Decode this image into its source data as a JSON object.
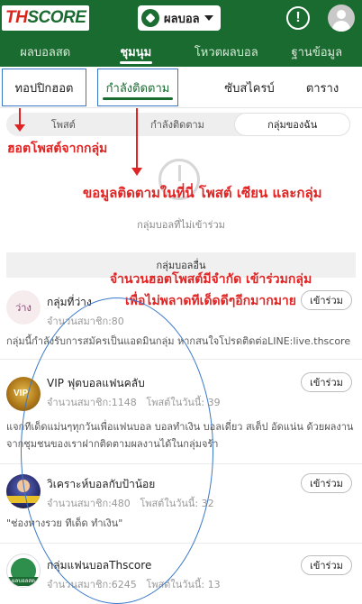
{
  "header": {
    "logo_th": "TH",
    "logo_score": "SCORE",
    "sport_select": "ผลบอล",
    "alert_icon": "!",
    "colors": {
      "brand_green": "#196b2f",
      "accent_red": "#e02424"
    }
  },
  "main_nav": {
    "tabs": [
      {
        "label": "ผลบอลสด"
      },
      {
        "label": "ชุมนุม"
      },
      {
        "label": "โหวตผลบอล"
      },
      {
        "label": "ฐานข้อมูล"
      }
    ]
  },
  "sub_tabs": {
    "tabs": [
      {
        "label": "ทอปปิกฮอต"
      },
      {
        "label": "กำลังติดตาม"
      },
      {
        "label": "ซับสไครบ์"
      },
      {
        "label": "ตาราง"
      }
    ]
  },
  "segment": {
    "options": [
      {
        "label": "โพสต์"
      },
      {
        "label": "กำลังติดตาม"
      },
      {
        "label": "กลุ่มของฉัน"
      }
    ]
  },
  "annotations": {
    "hot": "ฮอตโพสต์จากกลุ่ม",
    "follow": "ขอมูลติดตามในที่นี่ โพสต์ เซียน และกลุ่ม",
    "limit_line1": "จำนวนฮอตโพสต์มีจำกัด เข้าร่วมกลุ่ม",
    "limit_line2": "เพื่อไม่พลาดทีเด็ดดีๆอีกมากมาย"
  },
  "empty_state": {
    "text": "กลุ่มบอลที่ไม่เข้าร่วม"
  },
  "section": {
    "title": "กลุ่มบอลอื่น"
  },
  "groups": [
    {
      "thumb_text": "ว่าง",
      "name": "กลุ่มที่ว่าง",
      "members": "จำนวนสมาชิก:80",
      "posts_today": "",
      "join": "เข้าร่วม",
      "desc": "กลุ่มนี้กำลังรับการสมัครเป็นแอดมินกลุ่ม หากสนใจโปรดติดต่อLINE:live.thscore"
    },
    {
      "thumb_text": "VIP",
      "name": "VIP ฟุตบอลแฟนคลับ",
      "members": "จำนวนสมาชิก:1148",
      "posts_today": "โพสต์ในวันนี้: 39",
      "join": "เข้าร่วม",
      "desc": "แจกทีเด็ดแม่นๆทุกวันเพื่อแฟนบอล บอลทำเงิน บอลเดี่ยว สเต็ป อัดแน่น ด้วยผลงานจากชุมชนของเราฝากติดตามผลงานได้ในกลุ่มจร้า"
    },
    {
      "thumb_text": "",
      "name": "วิเคราะห์บอลกับป้าน้อย",
      "members": "จำนวนสมาชิก:480",
      "posts_today": "โพสต์ในวันนี้: 32",
      "join": "เข้าร่วม",
      "desc": "\"ช่องทางรวย ทีเด็ด ทำเงิน\""
    },
    {
      "thumb_text": "ผลบอลสด",
      "name": "กลุ่มแฟนบอลThscore",
      "members": "จำนวนสมาชิก:6245",
      "posts_today": "โพสต์ในวันนี้: 13",
      "join": "เข้าร่วม",
      "desc": ""
    }
  ]
}
